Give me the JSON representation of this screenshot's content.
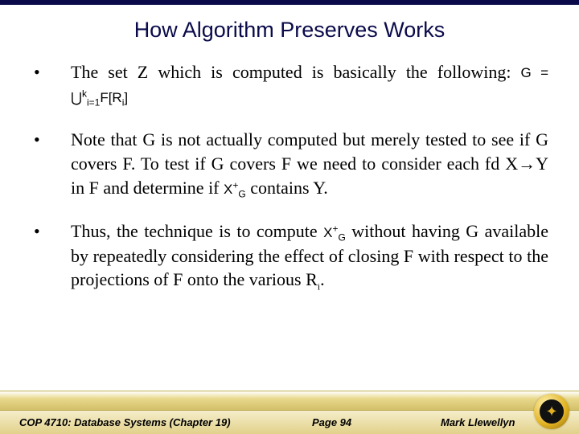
{
  "title": "How Algorithm Preserves Works",
  "bullets": [
    {
      "text_before": "The set Z which is computed is basically the following:  ",
      "formula": "G = ⋃",
      "formula_sub": "i=1",
      "formula_sup": "k",
      "formula_after": "F[R",
      "formula_after_sub": "i",
      "formula_close": "]",
      "text_after": ""
    },
    {
      "text_before": "Note that G is not actually computed but merely tested to see if G covers F.  To test if G covers F we need to consider each fd X→Y in F and determine if ",
      "formula": "X",
      "formula_sub": "G",
      "formula_sup": "+",
      "formula_after": "",
      "formula_after_sub": "",
      "formula_close": "",
      "text_after": " contains Y."
    },
    {
      "text_before": "Thus, the technique is to compute ",
      "formula": "X",
      "formula_sub": "G",
      "formula_sup": "+",
      "formula_after": "",
      "formula_after_sub": "",
      "formula_close": "",
      "text_after": " without having G available by repeatedly considering the effect of closing F with respect to the projections of F onto the various R",
      "text_after_sub": "i",
      "text_after_close": "."
    }
  ],
  "footer": {
    "left": "COP 4710: Database Systems  (Chapter 19)",
    "center": "Page 94",
    "right": "Mark Llewellyn"
  }
}
